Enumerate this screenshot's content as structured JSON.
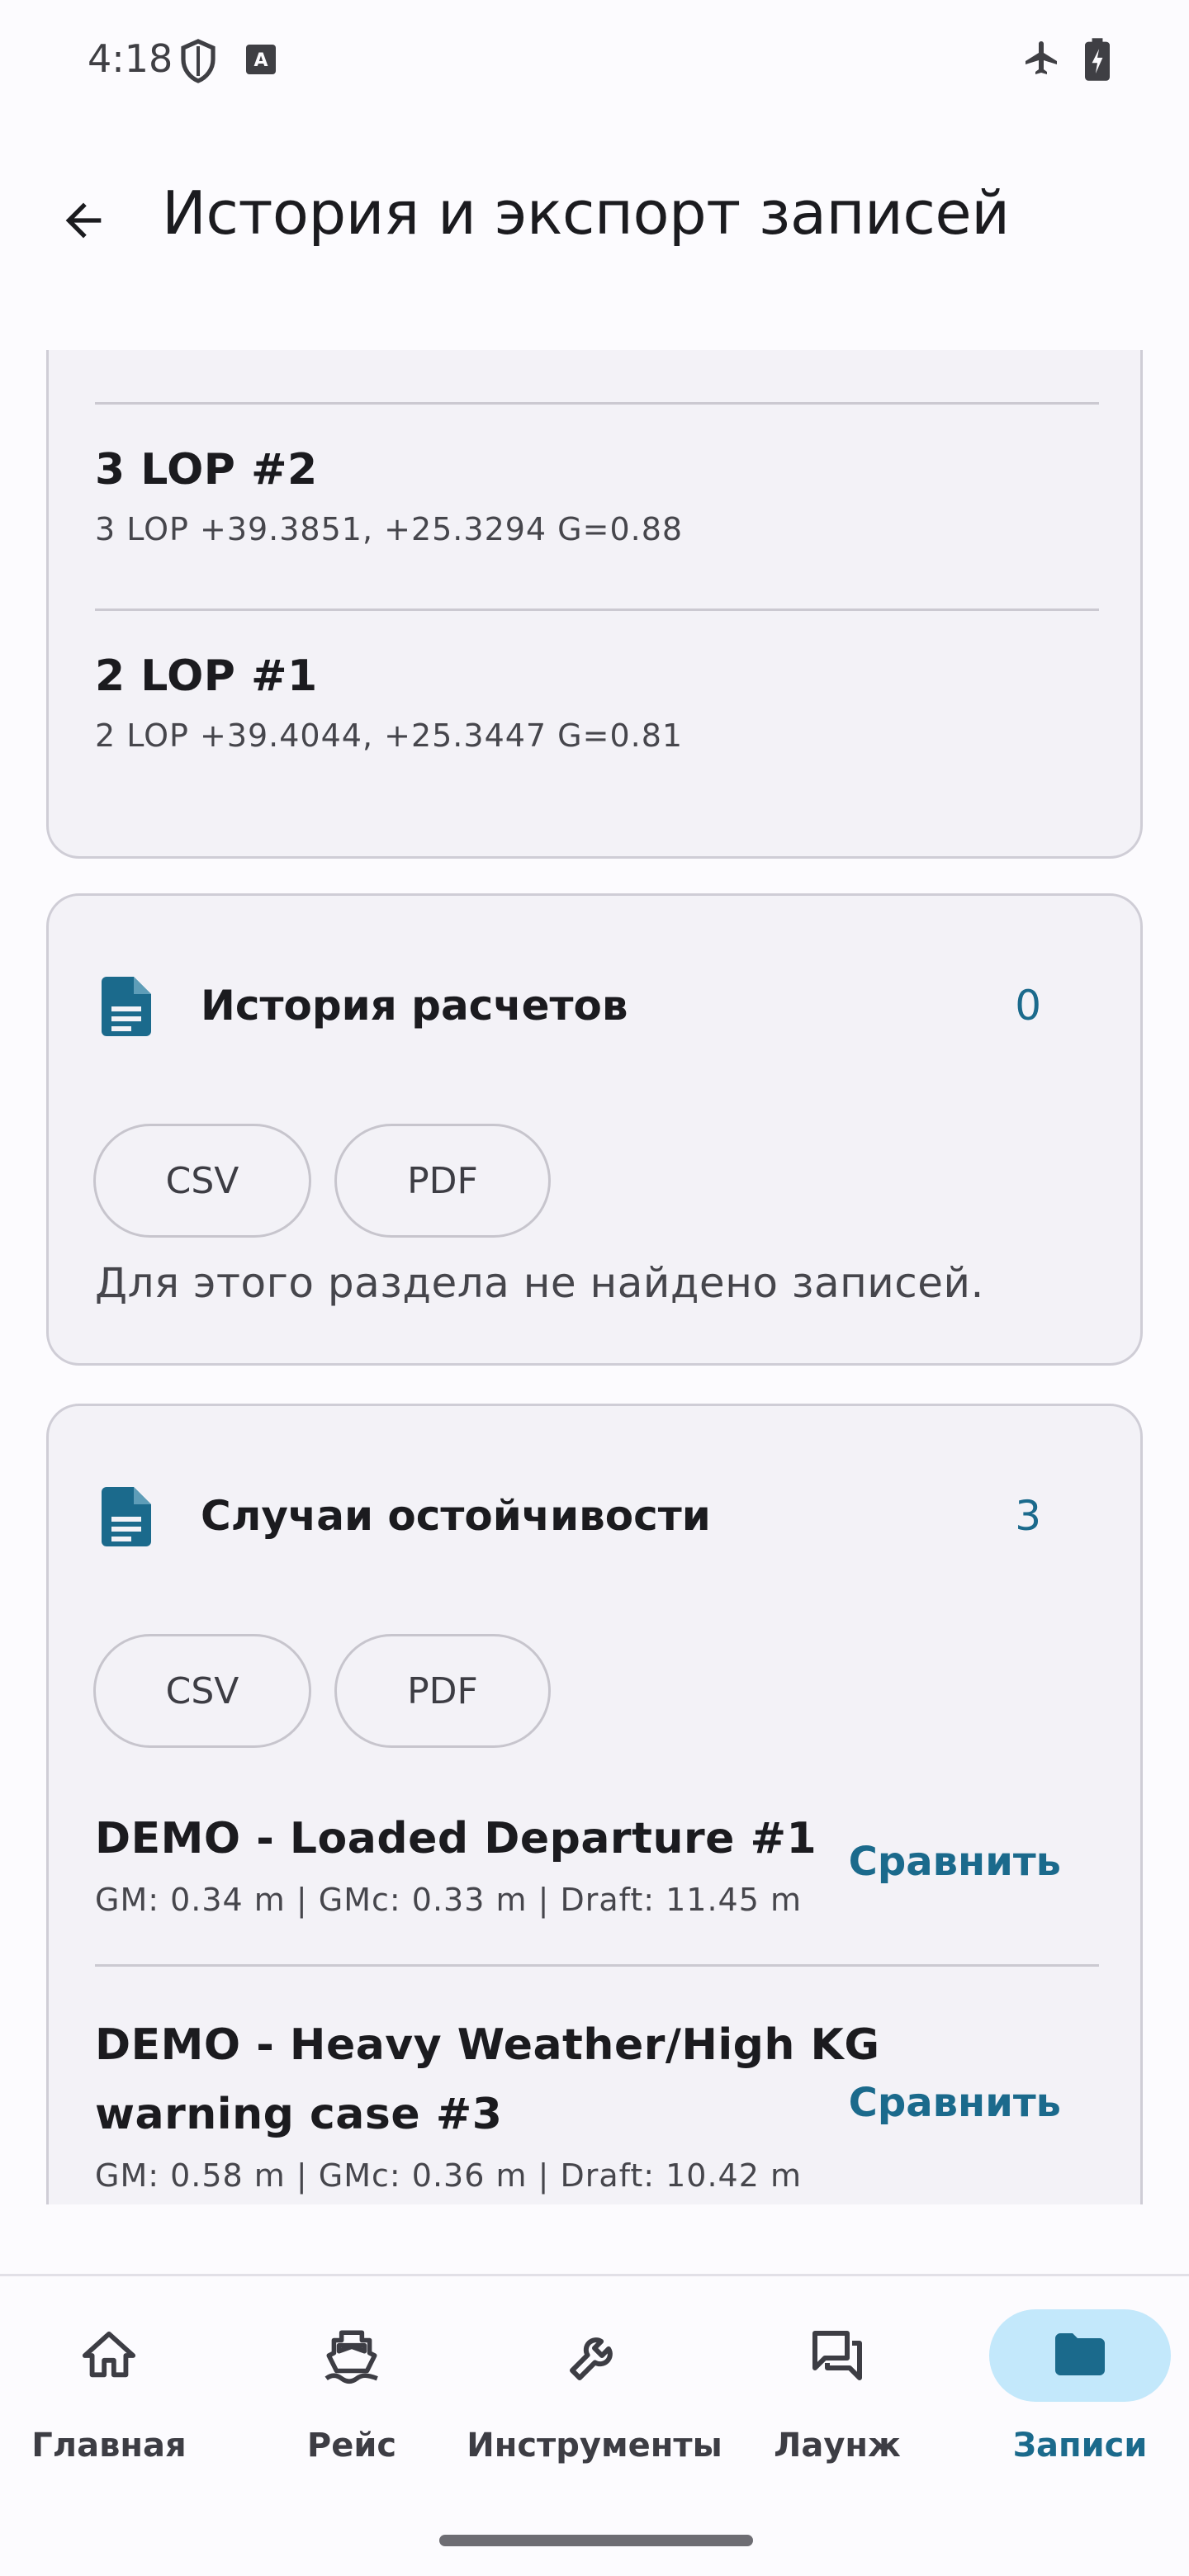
{
  "status_bar": {
    "time": "4:18",
    "icons": [
      "shield-icon",
      "keyboard-a-icon",
      "airplane-icon",
      "battery-charging-icon"
    ]
  },
  "app_bar": {
    "back_icon": "arrow-back-icon",
    "title": "История и экспорт записей"
  },
  "lop_list": {
    "items": [
      {
        "title": "3 LOP #2",
        "subtitle": "3 LOP +39.3851, +25.3294 G=0.88"
      },
      {
        "title": "2 LOP #1",
        "subtitle": "2 LOP +39.4044, +25.3447 G=0.81"
      }
    ]
  },
  "calc_history": {
    "icon": "document-icon",
    "title": "История расчетов",
    "count": "0",
    "chip_csv": "CSV",
    "chip_pdf": "PDF",
    "empty_text": "Для этого раздела не найдено записей."
  },
  "stability_cases": {
    "icon": "document-icon",
    "title": "Случаи остойчивости",
    "count": "3",
    "chip_csv": "CSV",
    "chip_pdf": "PDF",
    "items": [
      {
        "title": "DEMO - Loaded Departure #1",
        "subtitle": "GM: 0.34 m | GMc: 0.33 m | Draft: 11.45 m",
        "action": "Сравнить"
      },
      {
        "title_line1": "DEMO - Heavy Weather/High KG",
        "title_line2": "warning case #3",
        "subtitle": "GM: 0.58 m | GMc: 0.36 m | Draft: 10.42 m",
        "action": "Сравнить"
      }
    ]
  },
  "bottom_nav": {
    "items": [
      {
        "label": "Главная",
        "icon": "home-icon"
      },
      {
        "label": "Рейс",
        "icon": "ship-icon"
      },
      {
        "label": "Инструменты",
        "icon": "wrench-icon"
      },
      {
        "label": "Лаунж",
        "icon": "chat-icon"
      },
      {
        "label": "Записи",
        "icon": "folder-icon",
        "active": true
      }
    ]
  },
  "colors": {
    "accent": "#1b6a8c",
    "active_nav_bg": "#c3e8fb",
    "card_bg": "#f3f2f7",
    "card_border": "#cfcdd6"
  }
}
